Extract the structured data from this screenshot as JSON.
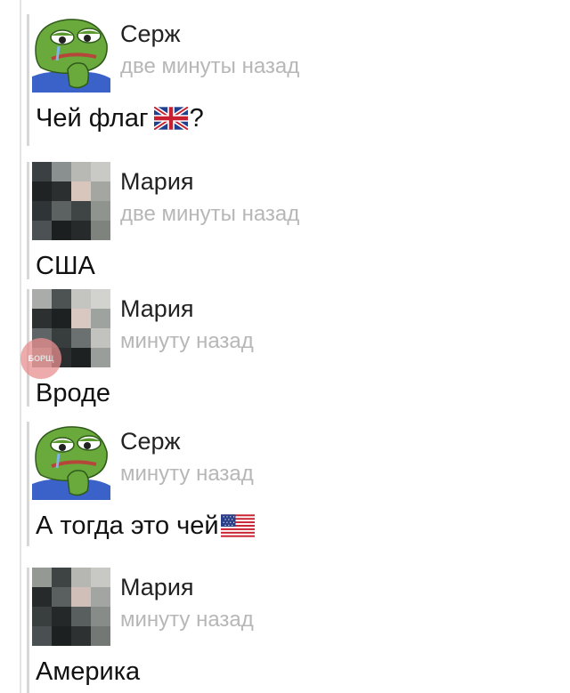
{
  "comments": [
    {
      "author": "Серж",
      "time": "две минуты назад",
      "text": "Чей флаг",
      "suffix": "?",
      "avatar_icon": "pepe-frog-icon",
      "flag_icon": "uk-flag-icon"
    },
    {
      "author": "Мария",
      "time": "две минуты назад",
      "text": "США",
      "avatar_icon": "pixelated-avatar"
    },
    {
      "author": "Мария",
      "time": "минуту назад",
      "text": "Вроде",
      "avatar_icon": "pixelated-avatar"
    },
    {
      "author": "Серж",
      "time": "минуту назад",
      "text": "А тогда это чей",
      "avatar_icon": "pepe-frog-icon",
      "flag_icon": "us-flag-icon"
    },
    {
      "author": "Мария",
      "time": "минуту назад",
      "text": "Америка",
      "avatar_icon": "pixelated-avatar"
    }
  ],
  "watermark": {
    "text": "БОРЩ",
    "color": "#e98f8f"
  },
  "colors": {
    "author": "#222222",
    "time": "#b7b7b7",
    "rule": "#d7d7d7"
  }
}
